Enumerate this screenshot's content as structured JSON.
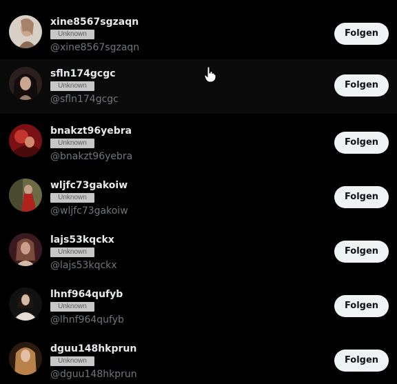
{
  "users": [
    {
      "name": "xine8567sgzaqn",
      "badge": "Unknown",
      "handle": "@xine8567sgzaqn",
      "button": "Folgen",
      "avatar_colors": [
        "#d8cfc6",
        "#8a6a55"
      ]
    },
    {
      "name": "sfln174gcgc",
      "badge": "Unknown",
      "handle": "@sfln174gcgc",
      "button": "Folgen",
      "avatar_colors": [
        "#2a1f1c",
        "#9a7a6a"
      ]
    },
    {
      "name": "bnakzt96yebra",
      "badge": "Unknown",
      "handle": "@bnakzt96yebra",
      "button": "Folgen",
      "avatar_colors": [
        "#7a0f14",
        "#c2362e"
      ]
    },
    {
      "name": "wljfc73gakoiw",
      "badge": "Unknown",
      "handle": "@wljfc73gakoiw",
      "button": "Folgen",
      "avatar_colors": [
        "#4a4a30",
        "#b0221c"
      ]
    },
    {
      "name": "lajs53kqckx",
      "badge": "Unknown",
      "handle": "@lajs53kqckx",
      "button": "Folgen",
      "avatar_colors": [
        "#3a1a20",
        "#caa08a"
      ]
    },
    {
      "name": "lhnf964qufyb",
      "badge": "Unknown",
      "handle": "@lhnf964qufyb",
      "button": "Folgen",
      "avatar_colors": [
        "#111111",
        "#e6dcd6"
      ]
    },
    {
      "name": "dguu148hkprun",
      "badge": "Unknown",
      "handle": "@dguu148hkprun",
      "button": "Folgen",
      "avatar_colors": [
        "#2a1a10",
        "#b8824a"
      ]
    }
  ],
  "hovered_row": 1,
  "cursor_icon": "hand-pointer-icon"
}
